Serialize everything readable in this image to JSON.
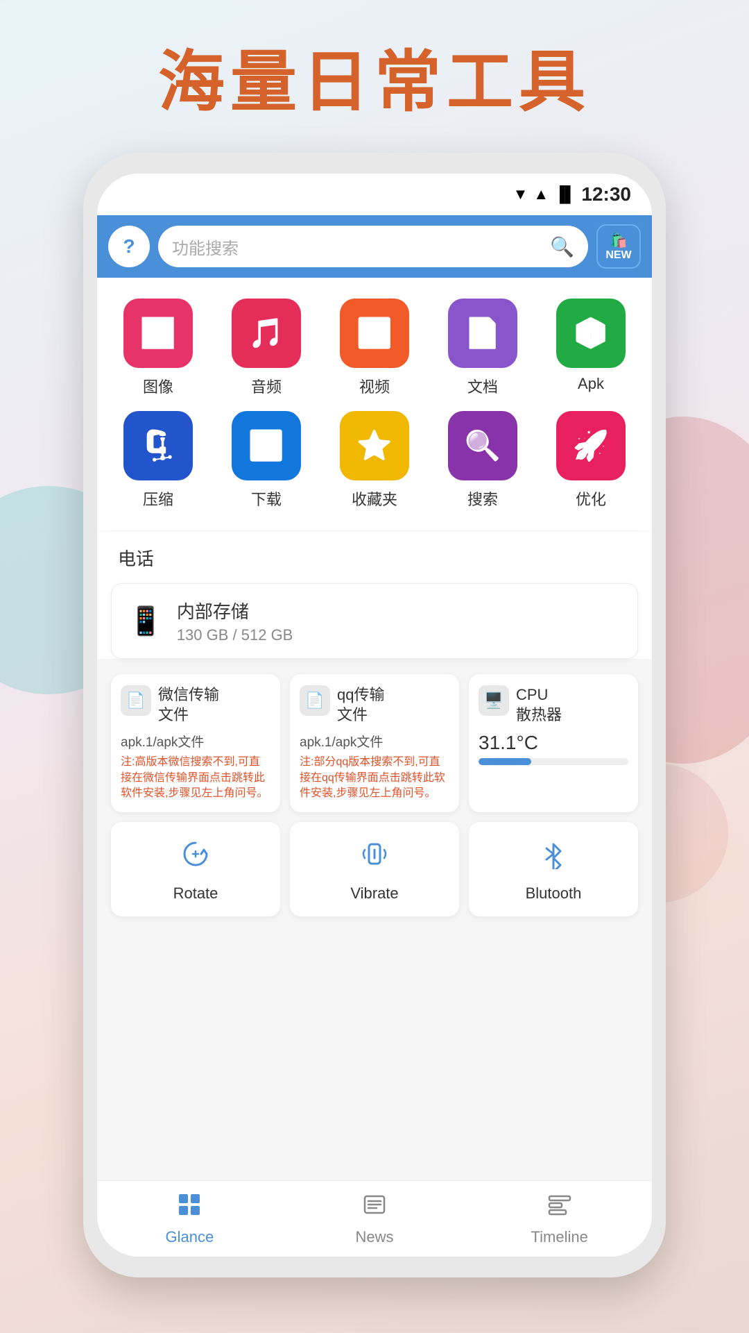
{
  "page": {
    "title": "海量日常工具",
    "status": {
      "time": "12:30",
      "wifi": "▼",
      "signal": "▲",
      "battery": "🔋"
    }
  },
  "topbar": {
    "help_label": "?",
    "search_placeholder": "功能搜索",
    "new_label": "NEW"
  },
  "icons_row1": [
    {
      "label": "图像",
      "emoji": "🖼️",
      "color": "ic-pink"
    },
    {
      "label": "音频",
      "emoji": "🎵",
      "color": "ic-red"
    },
    {
      "label": "视频",
      "emoji": "▶️",
      "color": "ic-orange"
    },
    {
      "label": "文档",
      "emoji": "📄",
      "color": "ic-purple"
    },
    {
      "label": "Apk",
      "emoji": "📦",
      "color": "ic-green"
    }
  ],
  "icons_row2": [
    {
      "label": "压缩",
      "emoji": "🗜️",
      "color": "ic-blue"
    },
    {
      "label": "下载",
      "emoji": "⬇️",
      "color": "ic-blue2"
    },
    {
      "label": "收藏夹",
      "emoji": "⭐",
      "color": "ic-yellow"
    },
    {
      "label": "搜索",
      "emoji": "🔍",
      "color": "ic-purple2"
    },
    {
      "label": "优化",
      "emoji": "🚀",
      "color": "ic-rose"
    }
  ],
  "phone_section": {
    "label": "电话",
    "storage_title": "内部存储",
    "storage_detail": "130 GB / 512 GB",
    "storage_icon": "📱"
  },
  "tool_cards": [
    {
      "title": "微信传输文件",
      "icon": "📄",
      "sub_title": "apk.1/apk文件",
      "note": "注:高版本微信搜索不到,可直接在微信传输界面点击跳转此软件安装,步骤见左上角问号。"
    },
    {
      "title": "qq传输文件",
      "icon": "📄",
      "sub_title": "apk.1/apk文件",
      "note": "注:部分qq版本搜索不到,可直接在qq传输界面点击跳转此软件安装,步骤见左上角问号。"
    },
    {
      "title": "CPU散热器",
      "icon": "🖥️",
      "temp": "31.1°C",
      "bar_percent": 35
    }
  ],
  "bottom_tools": [
    {
      "label": "Rotate",
      "icon": "rotate"
    },
    {
      "label": "Vibrate",
      "icon": "vibrate"
    },
    {
      "label": "Blutooth",
      "icon": "bluetooth"
    }
  ],
  "bottom_nav": [
    {
      "label": "Glance",
      "icon": "grid",
      "active": true
    },
    {
      "label": "News",
      "icon": "news",
      "active": false
    },
    {
      "label": "Timeline",
      "icon": "timeline",
      "active": false
    }
  ]
}
